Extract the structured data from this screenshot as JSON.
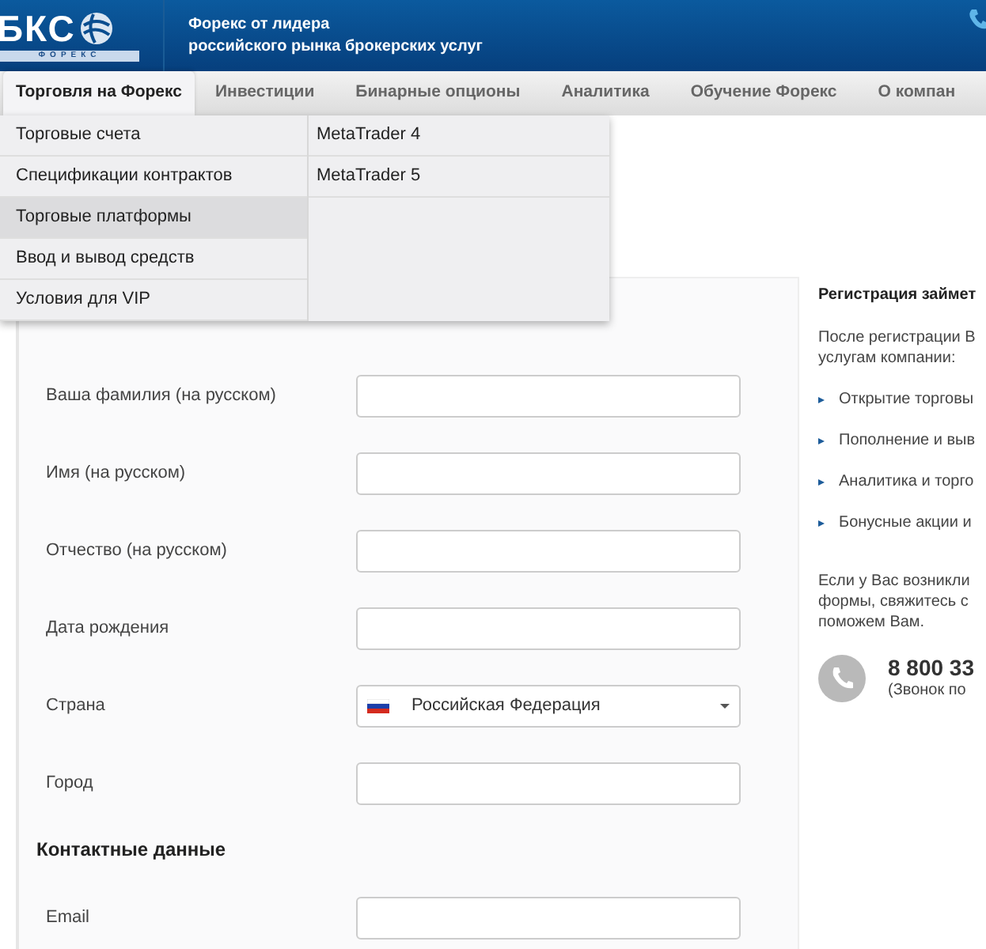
{
  "header": {
    "logo": {
      "letters": "БКС",
      "caption": "ФОРЕКС"
    },
    "tagline": "Форекс от лидера\nроссийского рынка брокерских услуг"
  },
  "nav": [
    {
      "label": "Торговля на Форекс",
      "selected": true
    },
    {
      "label": "Инвестиции",
      "selected": false
    },
    {
      "label": "Бинарные опционы",
      "selected": false
    },
    {
      "label": "Аналитика",
      "selected": false
    },
    {
      "label": "Обучение Форекс",
      "selected": false
    },
    {
      "label": "О компан",
      "selected": false
    }
  ],
  "dropdown": {
    "items": [
      {
        "label": "Торговые счета",
        "selected": false
      },
      {
        "label": "Спецификации контрактов",
        "selected": false
      },
      {
        "label": "Торговые платформы",
        "selected": true
      },
      {
        "label": "Ввод и вывод средств",
        "selected": false
      },
      {
        "label": "Условия для VIP",
        "selected": false
      }
    ],
    "submenu": [
      "MetaTrader 4",
      "MetaTrader 5"
    ]
  },
  "form": {
    "fields": [
      {
        "label": "Ваша фамилия (на русском)",
        "kind": "text"
      },
      {
        "label": "Имя (на русском)",
        "kind": "text"
      },
      {
        "label": "Отчество (на русском)",
        "kind": "text"
      },
      {
        "label": "Дата рождения",
        "kind": "text"
      },
      {
        "label": "Страна",
        "kind": "select",
        "value": "Российская Федерация"
      },
      {
        "label": "Город",
        "kind": "text"
      }
    ],
    "section_title": "Контактные данные",
    "contact_fields": [
      {
        "label": "Email",
        "kind": "text"
      }
    ]
  },
  "sidebar": {
    "title": "Регистрация займет",
    "intro": [
      "После регистрации В",
      "услугам компании:"
    ],
    "bullets": [
      "Открытие торговы",
      "Пополнение и выв",
      "Аналитика и торго",
      "Бонусные акции и"
    ],
    "help": [
      "Если у Вас возникли",
      "формы, свяжитесь с",
      "поможем Вам."
    ],
    "phone": "8 800 33",
    "phone_note": "(Звонок по"
  }
}
